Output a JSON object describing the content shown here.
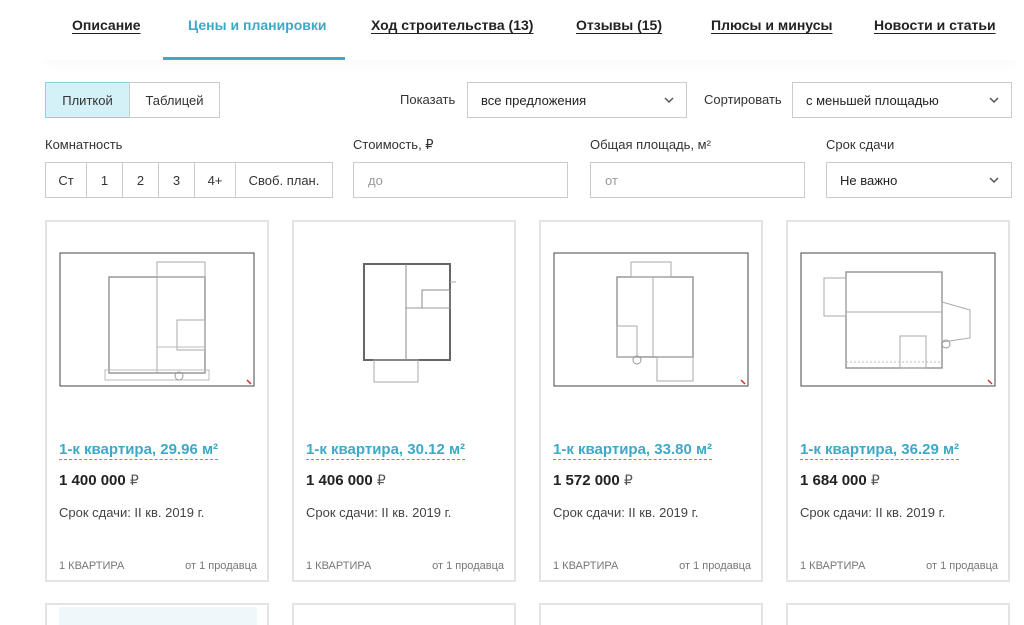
{
  "tabs": [
    {
      "label": "Описание",
      "active": false
    },
    {
      "label": "Цены и планировки",
      "active": true
    },
    {
      "label": "Ход строительства (13)",
      "active": false
    },
    {
      "label": "Отзывы (15)",
      "active": false
    },
    {
      "label": "Плюсы и минусы",
      "active": false
    },
    {
      "label": "Новости и статьи",
      "active": false
    }
  ],
  "toolbar": {
    "view_tiles": "Плиткой",
    "view_table": "Таблицей",
    "show_label": "Показать",
    "show_value": "все предложения",
    "sort_label": "Сортировать",
    "sort_value": "с меньшей площадью"
  },
  "filters": {
    "rooms_label": "Комнатность",
    "rooms": [
      "Ст",
      "1",
      "2",
      "3",
      "4+",
      "Своб. план."
    ],
    "price_label": "Стоимость, ₽",
    "price_placeholder": "до",
    "area_label": "Общая площадь, м²",
    "area_placeholder": "от",
    "deadline_label": "Срок сдачи",
    "deadline_value": "Не важно"
  },
  "cards": [
    {
      "title": "1-к квартира, 29.96 м²",
      "price": "1 400 000",
      "currency": "₽",
      "deadline": "Срок сдачи: II кв. 2019 г.",
      "count": "1 КВАРТИРА",
      "sellers": "от 1 продавца"
    },
    {
      "title": "1-к квартира, 30.12 м²",
      "price": "1 406 000",
      "currency": "₽",
      "deadline": "Срок сдачи: II кв. 2019 г.",
      "count": "1 КВАРТИРА",
      "sellers": "от 1 продавца"
    },
    {
      "title": "1-к квартира, 33.80 м²",
      "price": "1 572 000",
      "currency": "₽",
      "deadline": "Срок сдачи: II кв. 2019 г.",
      "count": "1 КВАРТИРА",
      "sellers": "от 1 продавца"
    },
    {
      "title": "1-к квартира, 36.29 м²",
      "price": "1 684 000",
      "currency": "₽",
      "deadline": "Срок сдачи: II кв. 2019 г.",
      "count": "1 КВАРТИРА",
      "sellers": "от 1 продавца"
    }
  ],
  "colors": {
    "accent": "#3ea8c6",
    "active_toggle_bg": "#d4f1f8",
    "border": "#cccccc"
  }
}
